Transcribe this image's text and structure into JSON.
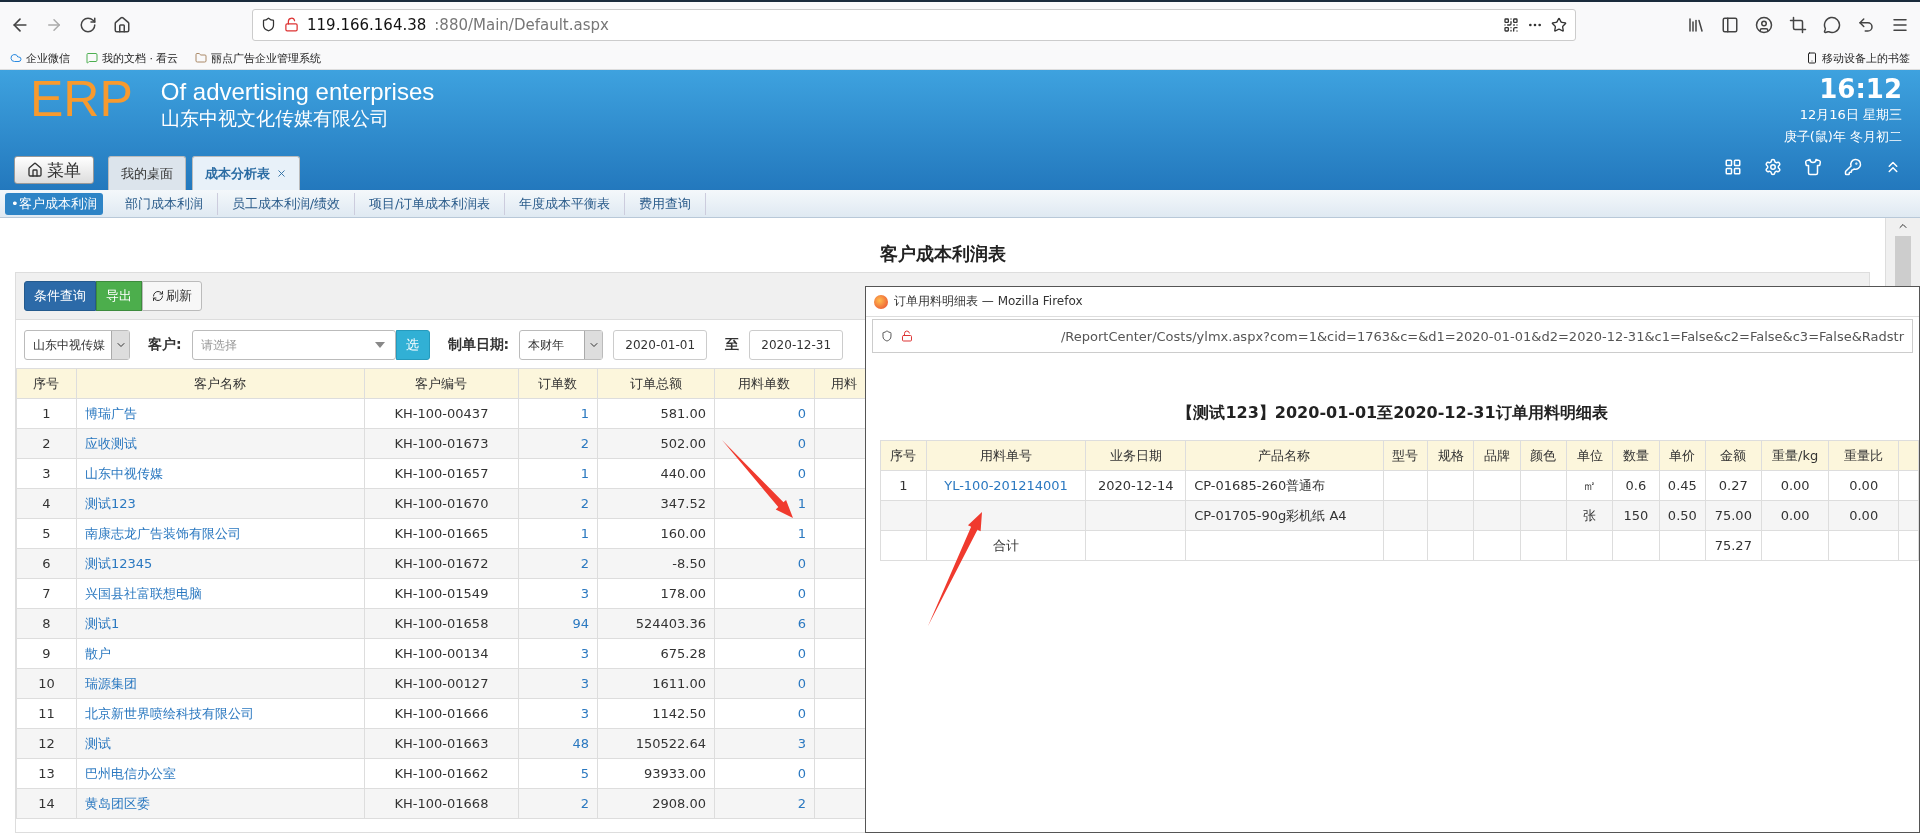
{
  "browser": {
    "url_host": "119.166.164.38",
    "url_path": ":880/Main/Default.aspx",
    "bookmarks": [
      "企业微信",
      "我的文档 · 看云",
      "丽点广告企业管理系统"
    ],
    "mobile_bookmarks": "移动设备上的书签"
  },
  "header": {
    "logo": "ERP",
    "subtitle": "Of advertising enterprises",
    "company": "山东中视文化传媒有限公司",
    "time": "16:12",
    "date": "12月16日 星期三",
    "lunar_date": "庚子(鼠)年 冬月初二",
    "menu_button": "菜单",
    "tabs": [
      {
        "label": "我的桌面",
        "selected": false,
        "closable": false
      },
      {
        "label": "成本分析表",
        "selected": true,
        "closable": true
      }
    ]
  },
  "subnav": [
    {
      "label": "•客户成本利润",
      "selected": true
    },
    {
      "label": "部门成本利润",
      "selected": false
    },
    {
      "label": "员工成本利润/绩效",
      "selected": false
    },
    {
      "label": "项目/订单成本利润表",
      "selected": false
    },
    {
      "label": "年度成本平衡表",
      "selected": false
    },
    {
      "label": "费用查询",
      "selected": false
    }
  ],
  "page_title": "客户成本利润表",
  "toolbar": [
    {
      "label": "条件查询",
      "kind": "primary"
    },
    {
      "label": "导出",
      "kind": "success"
    },
    {
      "label": "刷新",
      "kind": "refresh"
    }
  ],
  "filters": {
    "company": "山东中视传媒",
    "customer_label": "客户:",
    "customer_placeholder": "请选择",
    "pick_button": "选",
    "date_label": "制单日期:",
    "period": "本财年",
    "date_from": "2020-01-01",
    "to_label": "至",
    "date_to": "2020-12-31"
  },
  "table": {
    "columns": [
      "序号",
      "客户名称",
      "客户编号",
      "订单数",
      "订单总额",
      "用料单数",
      "用料"
    ],
    "rows": [
      {
        "no": "1",
        "name": "博瑞广告",
        "code": "KH-100-00437",
        "orders": "1",
        "total": "581.00",
        "materials": "0"
      },
      {
        "no": "2",
        "name": "应收测试",
        "code": "KH-100-01673",
        "orders": "2",
        "total": "502.00",
        "materials": "0"
      },
      {
        "no": "3",
        "name": "山东中视传媒",
        "code": "KH-100-01657",
        "orders": "1",
        "total": "440.00",
        "materials": "0"
      },
      {
        "no": "4",
        "name": "测试123",
        "code": "KH-100-01670",
        "orders": "2",
        "total": "347.52",
        "materials": "1"
      },
      {
        "no": "5",
        "name": "南康志龙广告装饰有限公司",
        "code": "KH-100-01665",
        "orders": "1",
        "total": "160.00",
        "materials": "1"
      },
      {
        "no": "6",
        "name": "测试12345",
        "code": "KH-100-01672",
        "orders": "2",
        "total": "-8.50",
        "materials": "0"
      },
      {
        "no": "7",
        "name": "兴国县社富联想电脑",
        "code": "KH-100-01549",
        "orders": "3",
        "total": "178.00",
        "materials": "0"
      },
      {
        "no": "8",
        "name": "测试1",
        "code": "KH-100-01658",
        "orders": "94",
        "total": "524403.36",
        "materials": "6"
      },
      {
        "no": "9",
        "name": "散户",
        "code": "KH-100-00134",
        "orders": "3",
        "total": "675.28",
        "materials": "0"
      },
      {
        "no": "10",
        "name": "瑞源集团",
        "code": "KH-100-00127",
        "orders": "3",
        "total": "1611.00",
        "materials": "0"
      },
      {
        "no": "11",
        "name": "北京新世界喷绘科技有限公司",
        "code": "KH-100-01666",
        "orders": "3",
        "total": "1142.50",
        "materials": "0"
      },
      {
        "no": "12",
        "name": "测试",
        "code": "KH-100-01663",
        "orders": "48",
        "total": "150522.64",
        "materials": "3"
      },
      {
        "no": "13",
        "name": "巴州电信办公室",
        "code": "KH-100-01662",
        "orders": "5",
        "total": "93933.00",
        "materials": "0"
      },
      {
        "no": "14",
        "name": "黄岛团区委",
        "code": "KH-100-01668",
        "orders": "2",
        "total": "2908.00",
        "materials": "2"
      }
    ]
  },
  "popup": {
    "title": "订单用料明细表 — Mozilla Firefox",
    "url": "/ReportCenter/Costs/ylmx.aspx?com=1&cid=1763&c=&d1=2020-01-01&d2=2020-12-31&c1=False&c2=False&c3=False&Radstr",
    "report_title": "【测试123】2020-01-01至2020-12-31订单用料明细表",
    "columns": [
      "序号",
      "用料单号",
      "业务日期",
      "产品名称",
      "型号",
      "规格",
      "品牌",
      "颜色",
      "单位",
      "数量",
      "单价",
      "金额",
      "重量/kg",
      "重量比"
    ],
    "rows": [
      {
        "kind": "item",
        "no": "1",
        "code": "YL-100-201214001",
        "date": "2020-12-14",
        "product": "CP-01685-260普通布",
        "unit": "㎡",
        "qty": "0.6",
        "price": "0.45",
        "amount": "0.27",
        "weight": "0.00",
        "ratio": "0.00"
      },
      {
        "kind": "item",
        "product": "CP-01705-90g彩机纸 A4",
        "unit": "张",
        "qty": "150",
        "price": "0.50",
        "amount": "75.00",
        "weight": "0.00",
        "ratio": "0.00"
      },
      {
        "kind": "total",
        "label": "合计",
        "amount": "75.27"
      }
    ]
  }
}
